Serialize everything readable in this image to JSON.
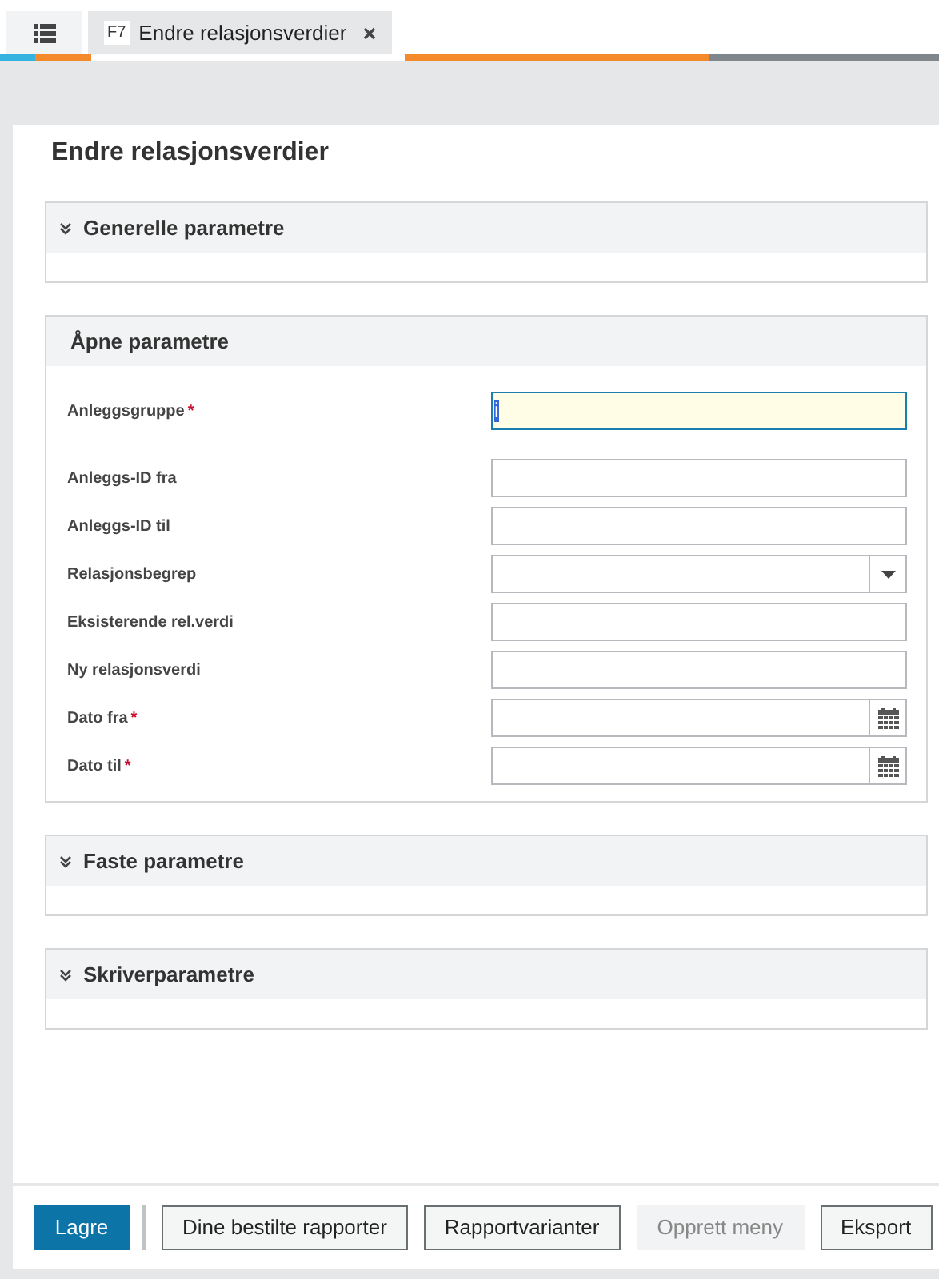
{
  "tabs": [
    {
      "kind": "menu",
      "selected": false
    },
    {
      "kind": "page",
      "key": "F7",
      "label": "Endre relasjonsverdier",
      "selected": true
    }
  ],
  "page_title": "Endre relasjonsverdier",
  "sections": [
    {
      "title": "Generelle parametre",
      "expanded": false
    },
    {
      "title": "Åpne parametre",
      "expanded": true,
      "fields": [
        {
          "label": "Anleggsgruppe",
          "required_mark": "*",
          "kind": "text",
          "value": "i",
          "focused": true
        },
        {
          "label": "Anleggs-ID fra",
          "kind": "text",
          "focused": false
        },
        {
          "label": "Anleggs-ID til",
          "kind": "text",
          "focused": false
        },
        {
          "label": "Relasjonsbegrep",
          "kind": "dropdown",
          "focused": false
        },
        {
          "label": "Eksisterende rel.verdi",
          "kind": "text",
          "focused": false
        },
        {
          "label": "Ny relasjonsverdi",
          "kind": "text",
          "focused": false
        },
        {
          "label": "Dato fra",
          "required_mark": "*",
          "kind": "date",
          "focused": false
        },
        {
          "label": "Dato til",
          "required_mark": "*",
          "kind": "date",
          "focused": false
        }
      ]
    },
    {
      "title": "Faste parametre",
      "expanded": false
    },
    {
      "title": "Skriverparametre",
      "expanded": false
    }
  ],
  "buttons": [
    {
      "label": "Lagre",
      "primary": true,
      "disabled": false
    },
    {
      "label": "Dine bestilte rapporter",
      "primary": false,
      "disabled": false
    },
    {
      "label": "Rapportvarianter",
      "primary": false,
      "disabled": false
    },
    {
      "label": "Opprett meny",
      "primary": false,
      "disabled": true
    },
    {
      "label": "Eksport",
      "primary": false,
      "disabled": false
    }
  ]
}
